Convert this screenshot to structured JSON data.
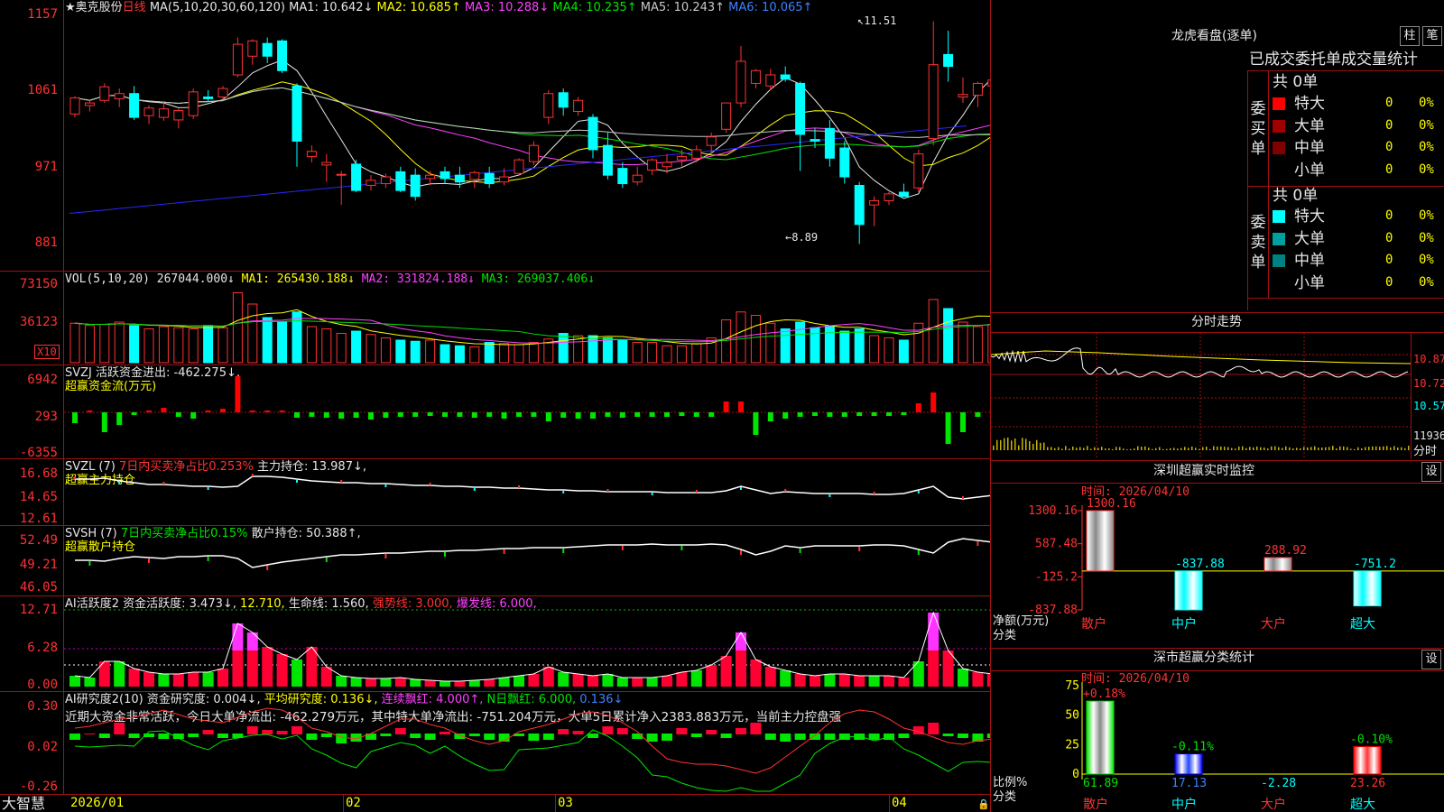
{
  "header": {
    "stock": "★奥克股份",
    "period": "日线",
    "ma_label": "MA(5,10,20,30,60,120)",
    "ma": [
      {
        "name": "MA1",
        "value": "10.642",
        "dir": "↓",
        "color": "#e6e6e6"
      },
      {
        "name": "MA2",
        "value": "10.685",
        "dir": "↑",
        "color": "#ffff00"
      },
      {
        "name": "MA3",
        "value": "10.288",
        "dir": "↓",
        "color": "#ff40ff"
      },
      {
        "name": "MA4",
        "value": "10.235",
        "dir": "↑",
        "color": "#00e600"
      },
      {
        "name": "MA5",
        "value": "10.243",
        "dir": "↑",
        "color": "#c8c8c8"
      },
      {
        "name": "MA6",
        "value": "10.065",
        "dir": "↑",
        "color": "#3c82ff"
      }
    ],
    "high_mark": "11.51",
    "low_mark": "8.89"
  },
  "kline_axis": [
    "1157",
    "1061",
    "971",
    "881"
  ],
  "vol": {
    "title": "VOL(5,10,20)",
    "value": "267044.000↓",
    "ma1": "MA1: 265430.188↓",
    "ma2": "MA2: 331824.188↓",
    "ma3": "MA3: 269037.406↓",
    "axis": [
      "73150",
      "36123"
    ],
    "unit": "X10"
  },
  "svzj": {
    "title": "SVZJ  活跃资金进出: -462.275↓,",
    "subtitle": "超赢资金流(万元)",
    "axis": [
      "6942",
      "293",
      "-6355"
    ]
  },
  "svzl": {
    "title": "SVZL (7)",
    "desc": "7日内买卖净占比0.253%",
    "main": "主力持仓: 13.987↓,",
    "subtitle": "超赢主力持仓",
    "axis": [
      "16.68",
      "14.65",
      "12.61"
    ]
  },
  "svsh": {
    "title": "SVSH (7)",
    "desc": "7日内买卖净占比0.15%",
    "main": "散户持仓: 50.388↑,",
    "subtitle": "超赢散户持仓",
    "axis": [
      "52.49",
      "49.21",
      "46.05"
    ]
  },
  "ai1": {
    "title": "AI活跃度2",
    "f1": "资金活跃度: 3.473↓,",
    "f2": "12.710,",
    "f3": "生命线: 1.560,",
    "f4": "强势线: 3.000,",
    "f5": "爆发线: 6.000,",
    "axis": [
      "12.71",
      "6.28",
      "0.00"
    ]
  },
  "ai2": {
    "title": "AI研究度2(10)",
    "f1": "资金研究度: 0.004↓,",
    "f2": "平均研究度: 0.136↓,",
    "f3": "连续飘红: 4.000↑,",
    "f4": "N日飘红: 6.000,",
    "f5": "0.136↓",
    "comment": "近期大资金非常活跃，今日大单净流出: -462.279万元，其中特大单净流出: -751.204万元，大单5日累计净入2383.883万元，当前主力控盘强",
    "axis": [
      "0.30",
      "0.02",
      "-0.26"
    ]
  },
  "dates": {
    "brand": "大智慧",
    "d1": "2026/01",
    "d2": "02",
    "d3": "03",
    "d4": "04"
  },
  "lhb": {
    "title": "龙虎看盘(逐单)",
    "btn1": "柱",
    "btn2": "笔",
    "subtitle": "已成交委托单成交量统计",
    "buy_label": "委买单",
    "sell_label": "委卖单",
    "buy_total": "共 0单",
    "sell_total": "共 0单",
    "buy_rows": [
      {
        "name": "特大",
        "value": "0",
        "pct": "0%",
        "color": "#ff0000"
      },
      {
        "name": "大单",
        "value": "0",
        "pct": "0%",
        "color": "#a00000"
      },
      {
        "name": "中单",
        "value": "0",
        "pct": "0%",
        "color": "#800000"
      },
      {
        "name": "小单",
        "value": "0",
        "pct": "0%",
        "color": ""
      }
    ],
    "sell_rows": [
      {
        "name": "特大",
        "value": "0",
        "pct": "0%",
        "color": "#00ffff"
      },
      {
        "name": "大单",
        "value": "0",
        "pct": "0%",
        "color": "#00a0a0"
      },
      {
        "name": "中单",
        "value": "0",
        "pct": "0%",
        "color": "#008080"
      },
      {
        "name": "小单",
        "value": "0",
        "pct": "0%",
        "color": ""
      }
    ]
  },
  "intraday": {
    "title": "分时走势",
    "p1": "10.87",
    "p2": "10.72",
    "p3": "10.57",
    "vol": "11936",
    "label": "分时"
  },
  "monitor": {
    "title": "深圳超赢实时监控",
    "btn": "设",
    "time": "时间: 2026/04/10",
    "axis": [
      "1300.16",
      "587.48",
      "-125.2",
      "-837.88"
    ],
    "ylabel": "净额(万元)",
    "xlabel": "分类",
    "bars": [
      {
        "cat": "散户",
        "value": 1300.16,
        "label": "1300.16"
      },
      {
        "cat": "中户",
        "value": -837.88,
        "label": "-837.88"
      },
      {
        "cat": "大户",
        "value": 288.92,
        "label": "288.92"
      },
      {
        "cat": "超大",
        "value": -751.2,
        "label": "-751.2"
      }
    ]
  },
  "classstat": {
    "title": "深市超赢分类统计",
    "btn": "设",
    "time": "时间: 2026/04/10",
    "axis": [
      "75",
      "50",
      "25",
      "0"
    ],
    "ylabel": "比例%",
    "xlabel": "分类",
    "bars": [
      {
        "cat": "散户",
        "value": 61.89,
        "label": "61.89",
        "delta": "+0.18%"
      },
      {
        "cat": "中户",
        "value": 17.13,
        "label": "17.13",
        "delta": "-0.11%"
      },
      {
        "cat": "大户",
        "value": -2.28,
        "label": "-2.28",
        "delta": ""
      },
      {
        "cat": "超大",
        "value": 23.26,
        "label": "23.26",
        "delta": "-0.10%"
      }
    ]
  },
  "chart_data": [
    {
      "type": "candlestick",
      "title": "奥克股份 日线",
      "ylim": [
        8.81,
        11.57
      ],
      "ohlc": [
        [
          10.42,
          10.63,
          10.38,
          10.61
        ],
        [
          10.52,
          10.58,
          10.45,
          10.55
        ],
        [
          10.58,
          10.78,
          10.55,
          10.74
        ],
        [
          10.6,
          10.72,
          10.5,
          10.66
        ],
        [
          10.66,
          10.75,
          10.35,
          10.38
        ],
        [
          10.4,
          10.52,
          10.3,
          10.49
        ],
        [
          10.38,
          10.56,
          10.34,
          10.48
        ],
        [
          10.35,
          10.48,
          10.25,
          10.46
        ],
        [
          10.4,
          10.72,
          10.36,
          10.68
        ],
        [
          10.62,
          10.7,
          10.56,
          10.6
        ],
        [
          10.62,
          10.75,
          10.58,
          10.72
        ],
        [
          10.88,
          11.32,
          10.85,
          11.24
        ],
        [
          11.1,
          11.3,
          11.0,
          11.28
        ],
        [
          11.25,
          11.32,
          11.02,
          11.1
        ],
        [
          11.28,
          11.3,
          10.9,
          10.93
        ],
        [
          10.75,
          10.78,
          9.8,
          10.1
        ],
        [
          9.92,
          10.05,
          9.85,
          9.98
        ],
        [
          9.82,
          9.95,
          9.62,
          9.85
        ],
        [
          9.7,
          9.75,
          9.35,
          9.71
        ],
        [
          9.83,
          9.88,
          9.5,
          9.52
        ],
        [
          9.58,
          9.7,
          9.52,
          9.64
        ],
        [
          9.6,
          9.72,
          9.55,
          9.68
        ],
        [
          9.74,
          9.8,
          9.5,
          9.52
        ],
        [
          9.7,
          9.78,
          9.4,
          9.45
        ],
        [
          9.66,
          9.75,
          9.58,
          9.7
        ],
        [
          9.74,
          9.8,
          9.6,
          9.66
        ],
        [
          9.7,
          9.8,
          9.55,
          9.62
        ],
        [
          9.65,
          9.75,
          9.55,
          9.73
        ],
        [
          9.72,
          9.8,
          9.55,
          9.6
        ],
        [
          9.62,
          9.78,
          9.58,
          9.68
        ],
        [
          9.72,
          9.9,
          9.7,
          9.88
        ],
        [
          9.86,
          10.1,
          9.82,
          10.05
        ],
        [
          10.38,
          10.7,
          10.3,
          10.66
        ],
        [
          10.67,
          10.72,
          10.4,
          10.5
        ],
        [
          10.45,
          10.62,
          10.4,
          10.58
        ],
        [
          10.38,
          10.42,
          9.9,
          10.0
        ],
        [
          10.05,
          10.2,
          9.65,
          9.7
        ],
        [
          9.78,
          9.85,
          9.55,
          9.6
        ],
        [
          9.62,
          9.8,
          9.58,
          9.7
        ],
        [
          9.76,
          9.9,
          9.7,
          9.88
        ],
        [
          9.8,
          9.95,
          9.72,
          9.85
        ],
        [
          9.88,
          10.0,
          9.8,
          9.92
        ],
        [
          9.9,
          10.05,
          9.85,
          10.0
        ],
        [
          10.05,
          10.2,
          9.95,
          10.15
        ],
        [
          10.24,
          10.55,
          10.2,
          10.55
        ],
        [
          10.55,
          11.22,
          10.5,
          11.04
        ],
        [
          10.78,
          10.95,
          10.72,
          10.93
        ],
        [
          10.75,
          10.95,
          10.7,
          10.88
        ],
        [
          10.88,
          10.98,
          10.8,
          10.83
        ],
        [
          10.78,
          10.8,
          9.75,
          10.18
        ],
        [
          10.12,
          10.25,
          10.02,
          10.1
        ],
        [
          10.25,
          10.35,
          9.8,
          9.9
        ],
        [
          10.02,
          10.1,
          9.6,
          9.68
        ],
        [
          9.58,
          9.62,
          8.89,
          9.12
        ],
        [
          9.35,
          9.45,
          9.1,
          9.4
        ],
        [
          9.4,
          9.5,
          9.35,
          9.48
        ],
        [
          9.5,
          9.6,
          9.45,
          9.45
        ],
        [
          9.55,
          10.0,
          9.5,
          9.95
        ],
        [
          10.13,
          11.51,
          10.05,
          11.0
        ],
        [
          11.12,
          11.4,
          10.8,
          10.98
        ],
        [
          10.62,
          10.85,
          10.55,
          10.65
        ],
        [
          10.64,
          10.8,
          10.5,
          10.78
        ],
        [
          10.75,
          10.9,
          10.6,
          10.82
        ],
        [
          11.05,
          11.15,
          10.85,
          10.85
        ],
        [
          10.65,
          10.88,
          10.5,
          10.82
        ],
        [
          10.78,
          10.98,
          10.7,
          10.9
        ],
        [
          10.86,
          11.0,
          10.8,
          10.84
        ],
        [
          10.8,
          11.13,
          10.75,
          10.91
        ]
      ]
    }
  ]
}
